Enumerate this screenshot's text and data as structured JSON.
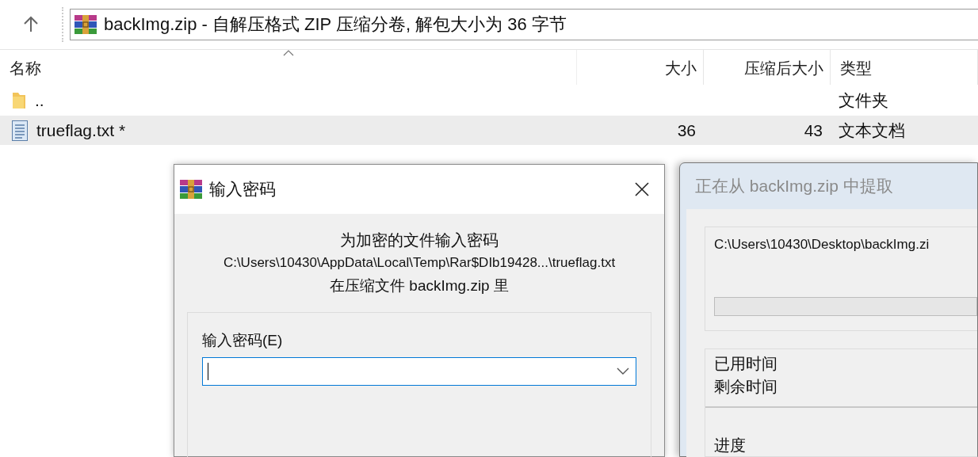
{
  "toolbar": {
    "address": "backImg.zip - 自解压格式 ZIP 压缩分卷, 解包大小为 36 字节"
  },
  "file_list": {
    "columns": [
      {
        "label": "名称",
        "sorted": true
      },
      {
        "label": "大小",
        "sorted": false
      },
      {
        "label": "压缩后大小",
        "sorted": false
      },
      {
        "label": "类型",
        "sorted": false
      }
    ],
    "rows": [
      {
        "kind": "folder",
        "name": "..",
        "type": "文件夹",
        "selected": false
      },
      {
        "kind": "file",
        "name": "trueflag.txt *",
        "size": "36",
        "packed": "43",
        "type": "文本文档",
        "selected": true
      }
    ]
  },
  "password_dialog": {
    "title": "输入密码",
    "prompt": "为加密的文件输入密码",
    "path": "C:\\Users\\10430\\AppData\\Local\\Temp\\Rar$DIb19428...\\trueflag.txt",
    "archive_note": "在压缩文件 backImg.zip 里",
    "field_label": "输入密码(E)",
    "focused": true
  },
  "extract_dialog": {
    "title": "正在从 backImg.zip 中提取",
    "active": false,
    "path": "C:\\Users\\10430\\Desktop\\backImg.zi",
    "progress": {
      "level": 0
    },
    "elapsed_label": "已用时间",
    "remaining_label": "剩余时间",
    "progress_label": "进度"
  }
}
